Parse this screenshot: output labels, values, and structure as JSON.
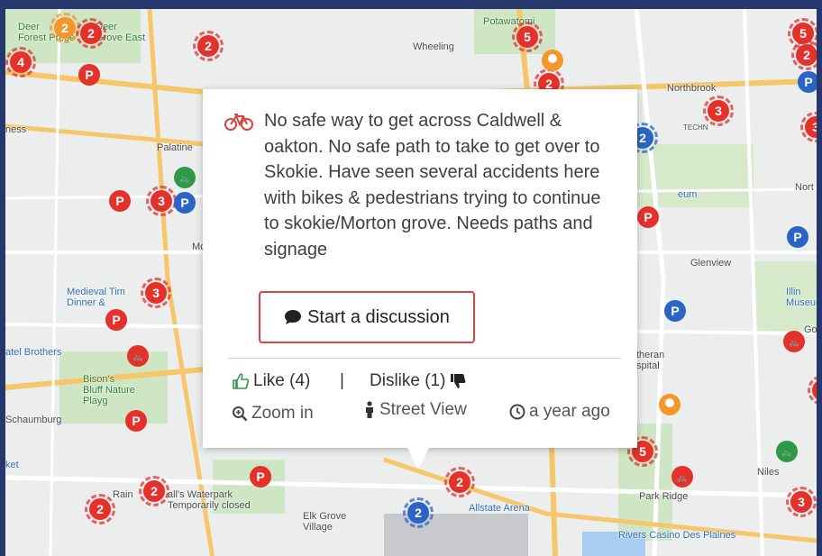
{
  "map": {
    "places": [
      {
        "id": "deer-forest-preserve",
        "label": "Deer\nForest Prese",
        "kind": "green"
      },
      {
        "id": "deer-grove-east",
        "label": "Deer\nGrove East",
        "kind": "green"
      },
      {
        "id": "wheeling",
        "label": "Wheeling",
        "kind": "normal"
      },
      {
        "id": "potawatomi",
        "label": "Potawatomi",
        "kind": "green"
      },
      {
        "id": "northbrook",
        "label": "Northbrook",
        "kind": "normal"
      },
      {
        "id": "ness",
        "label": "ness",
        "kind": "normal"
      },
      {
        "id": "palatine",
        "label": "Palatine",
        "kind": "normal"
      },
      {
        "id": "north",
        "label": "Nort",
        "kind": "normal"
      },
      {
        "id": "glenview",
        "label": "Glenview",
        "kind": "normal"
      },
      {
        "id": "medieval-times",
        "label": "Medieval Tim\nDinner &",
        "kind": "blue"
      },
      {
        "id": "patel-brothers",
        "label": "atel Brothers",
        "kind": "blue"
      },
      {
        "id": "bisons-bluff",
        "label": "Bison's\nBluff Nature\nPlayg",
        "kind": "green"
      },
      {
        "id": "schaumburg",
        "label": "Schaumburg",
        "kind": "normal"
      },
      {
        "id": "illinois-museum",
        "label": "Illin\nMuseum",
        "kind": "blue"
      },
      {
        "id": "hospital",
        "label": "theran\nspital",
        "kind": "normal"
      },
      {
        "id": "niles",
        "label": "Niles",
        "kind": "normal"
      },
      {
        "id": "park-ridge",
        "label": "Park Ridge",
        "kind": "normal"
      },
      {
        "id": "elk-grove",
        "label": "Elk Grove\nVillage",
        "kind": "normal"
      },
      {
        "id": "rains",
        "label": "Rain",
        "kind": "normal"
      },
      {
        "id": "waterpark",
        "label": "all's Waterpark\nTemporarily closed",
        "kind": "normal"
      },
      {
        "id": "allstate-arena",
        "label": "Allstate Arena",
        "kind": "blue"
      },
      {
        "id": "rivers-casino",
        "label": "Rivers Casino Des Plaines",
        "kind": "blue"
      },
      {
        "id": "ket",
        "label": "ket",
        "kind": "blue"
      },
      {
        "id": "techny",
        "label": "TECHN",
        "kind": "normal"
      },
      {
        "id": "museum",
        "label": "eum",
        "kind": "blue"
      },
      {
        "id": "mo",
        "label": "Mo",
        "kind": "normal"
      },
      {
        "id": "go",
        "label": "Go",
        "kind": "normal"
      }
    ],
    "clusters": [
      {
        "label": "2",
        "color": "orange"
      },
      {
        "label": "2",
        "color": "red"
      },
      {
        "label": "2",
        "color": "red"
      },
      {
        "label": "4",
        "color": "red"
      },
      {
        "label": "5",
        "color": "red"
      },
      {
        "label": "2",
        "color": "red"
      },
      {
        "label": "5",
        "color": "red"
      },
      {
        "label": "2",
        "color": "red"
      },
      {
        "label": "3",
        "color": "red"
      },
      {
        "label": "3",
        "color": "red"
      },
      {
        "label": "3",
        "color": "red"
      },
      {
        "label": "3",
        "color": "red"
      },
      {
        "label": "5",
        "color": "red"
      },
      {
        "label": "2",
        "color": "red"
      },
      {
        "label": "2",
        "color": "red"
      },
      {
        "label": "2",
        "color": "red"
      },
      {
        "label": "2",
        "color": "blue"
      },
      {
        "label": "3",
        "color": "red"
      },
      {
        "label": "2",
        "color": "blue"
      },
      {
        "label": "4",
        "color": "red"
      }
    ]
  },
  "popup": {
    "category_icon": "bicycle-icon",
    "message": "No safe way to get across Caldwell & oakton. No safe path to take to get over to Skokie. Have seen several accidents here with bikes & pedestrians trying to continue to skokie/Morton grove. Needs paths and signage",
    "discuss_label": "Start a discussion",
    "like_label": "Like (4)",
    "separator": "|",
    "dislike_label": "Dislike (1)",
    "zoom_label": "Zoom in",
    "street_view_label": "Street View",
    "time_label": "a year ago",
    "accent_color": "#d9433d"
  }
}
